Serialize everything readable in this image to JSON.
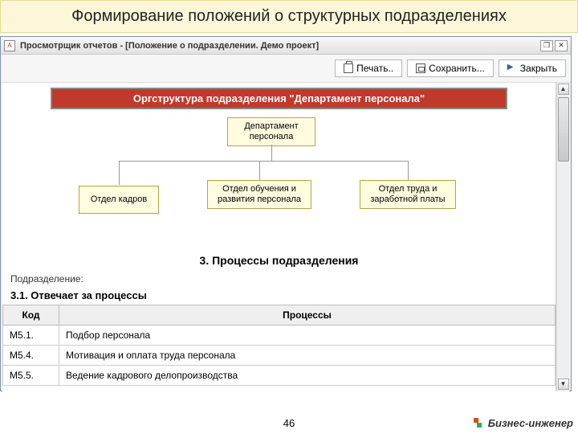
{
  "slide": {
    "title": "Формирование положений о структурных подразделениях"
  },
  "window": {
    "app_icon": "А",
    "title": "Просмотрщик отчетов - [Положение о подразделении. Демо проект]"
  },
  "toolbar": {
    "print": "Печать..",
    "save": "Сохранить...",
    "close": "Закрыть"
  },
  "org": {
    "header": "Оргструктура подразделения \"Департамент персонала\"",
    "root": "Департамент персонала",
    "children": [
      "Отдел кадров",
      "Отдел обучения и развития персонала",
      "Отдел труда и заработной платы"
    ]
  },
  "section": {
    "number_title": "3. Процессы подразделения",
    "sub_label": "Подразделение:",
    "responsible": "3.1. Отвечает за процессы"
  },
  "table": {
    "head_code": "Код",
    "head_proc": "Процессы",
    "rows": [
      {
        "code": "М5.1.",
        "proc": "Подбор персонала"
      },
      {
        "code": "М5.4.",
        "proc": "Мотивация и оплата труда персонала"
      },
      {
        "code": "М5.5.",
        "proc": "Ведение кадрового делопроизводства"
      }
    ]
  },
  "footer": {
    "page": "46",
    "brand": "Бизнес-инженер"
  }
}
